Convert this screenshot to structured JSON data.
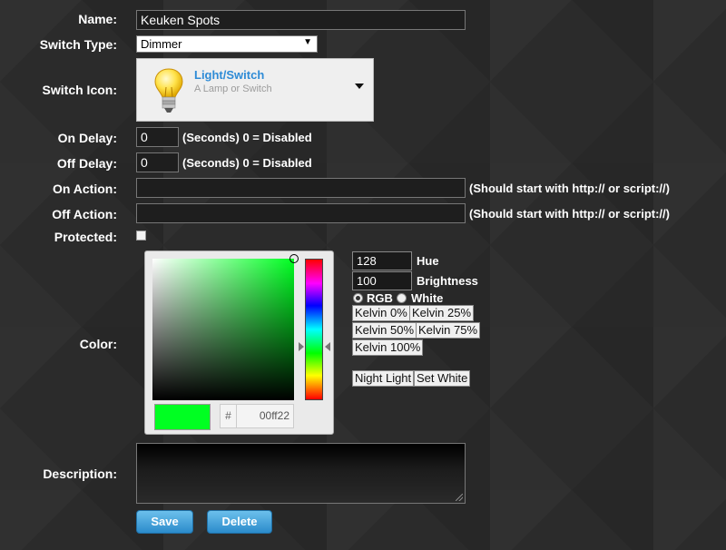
{
  "form": {
    "name": {
      "label": "Name:",
      "value": "Keuken Spots"
    },
    "switch_type": {
      "label": "Switch Type:",
      "value": "Dimmer"
    },
    "switch_icon": {
      "label": "Switch Icon:",
      "title": "Light/Switch",
      "subtitle": "A Lamp or Switch",
      "icon": "lightbulb-icon"
    },
    "on_delay": {
      "label": "On Delay:",
      "value": "0",
      "hint": "(Seconds) 0 = Disabled"
    },
    "off_delay": {
      "label": "Off Delay:",
      "value": "0",
      "hint": "(Seconds) 0 = Disabled"
    },
    "on_action": {
      "label": "On Action:",
      "value": "",
      "hint": "(Should start with http:// or script://)"
    },
    "off_action": {
      "label": "Off Action:",
      "value": "",
      "hint": "(Should start with http:// or script://)"
    },
    "protected": {
      "label": "Protected:",
      "checked": false
    },
    "color": {
      "label": "Color:",
      "selected": "#00ff22",
      "hash": "#",
      "hex": "00ff22",
      "hue": {
        "value": "128",
        "label": "Hue"
      },
      "brightness": {
        "value": "100",
        "label": "Brightness"
      },
      "mode_rgb": "RGB",
      "mode_white": "White",
      "mode_selected": "RGB",
      "presets": [
        "Kelvin 0%",
        "Kelvin 25%",
        "Kelvin 50%",
        "Kelvin 75%",
        "Kelvin 100%"
      ],
      "night_light": "Night Light",
      "set_white": "Set White"
    },
    "description": {
      "label": "Description:",
      "value": ""
    }
  },
  "buttons": {
    "save": "Save",
    "delete": "Delete"
  },
  "colors": {
    "accent": "#2e8bd6",
    "button": "#2b8bcb",
    "background": "#2b2b2b"
  }
}
